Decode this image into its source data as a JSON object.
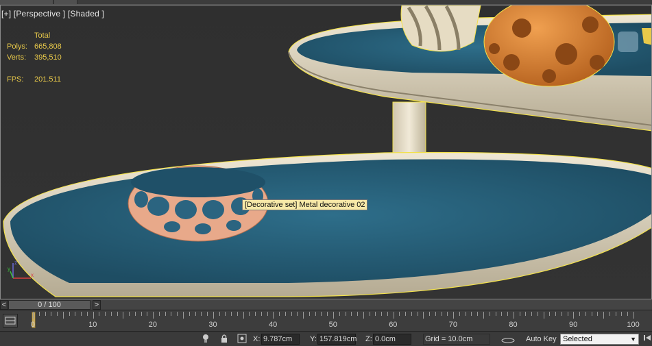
{
  "viewport": {
    "label": "[+] [Perspective ] [Shaded ]",
    "stats": {
      "total_label": "Total",
      "polys_label": "Polys:",
      "polys_value": "665,808",
      "verts_label": "Verts:",
      "verts_value": "395,510",
      "fps_label": "FPS:",
      "fps_value": "201.511"
    },
    "tooltip": "[Decorative set] Metal decorative 02",
    "axis": {
      "x": "x",
      "y": "y",
      "z": "z"
    }
  },
  "timeslider": {
    "prev": "<",
    "next": ">",
    "frame": "0 / 100"
  },
  "trackbar": {
    "numbers": [
      "0",
      "10",
      "20",
      "30",
      "40",
      "50",
      "60",
      "70",
      "80",
      "90",
      "100"
    ]
  },
  "statusbar": {
    "x_label": "X:",
    "x_value": "9.787cm",
    "y_label": "Y:",
    "y_value": "157.819cm",
    "z_label": "Z:",
    "z_value": "0.0cm",
    "grid": "Grid = 10.0cm",
    "auto_key": "Auto Key",
    "selection_set": "Selected"
  },
  "colors": {
    "selection_outline": "#f2e14a",
    "tray_inner": "#2b6480",
    "tray_rim": "#d9cfb7",
    "decor_front": "#e0a07e",
    "decor_back": "#cf7a2a",
    "stats_text": "#e8c94a"
  }
}
